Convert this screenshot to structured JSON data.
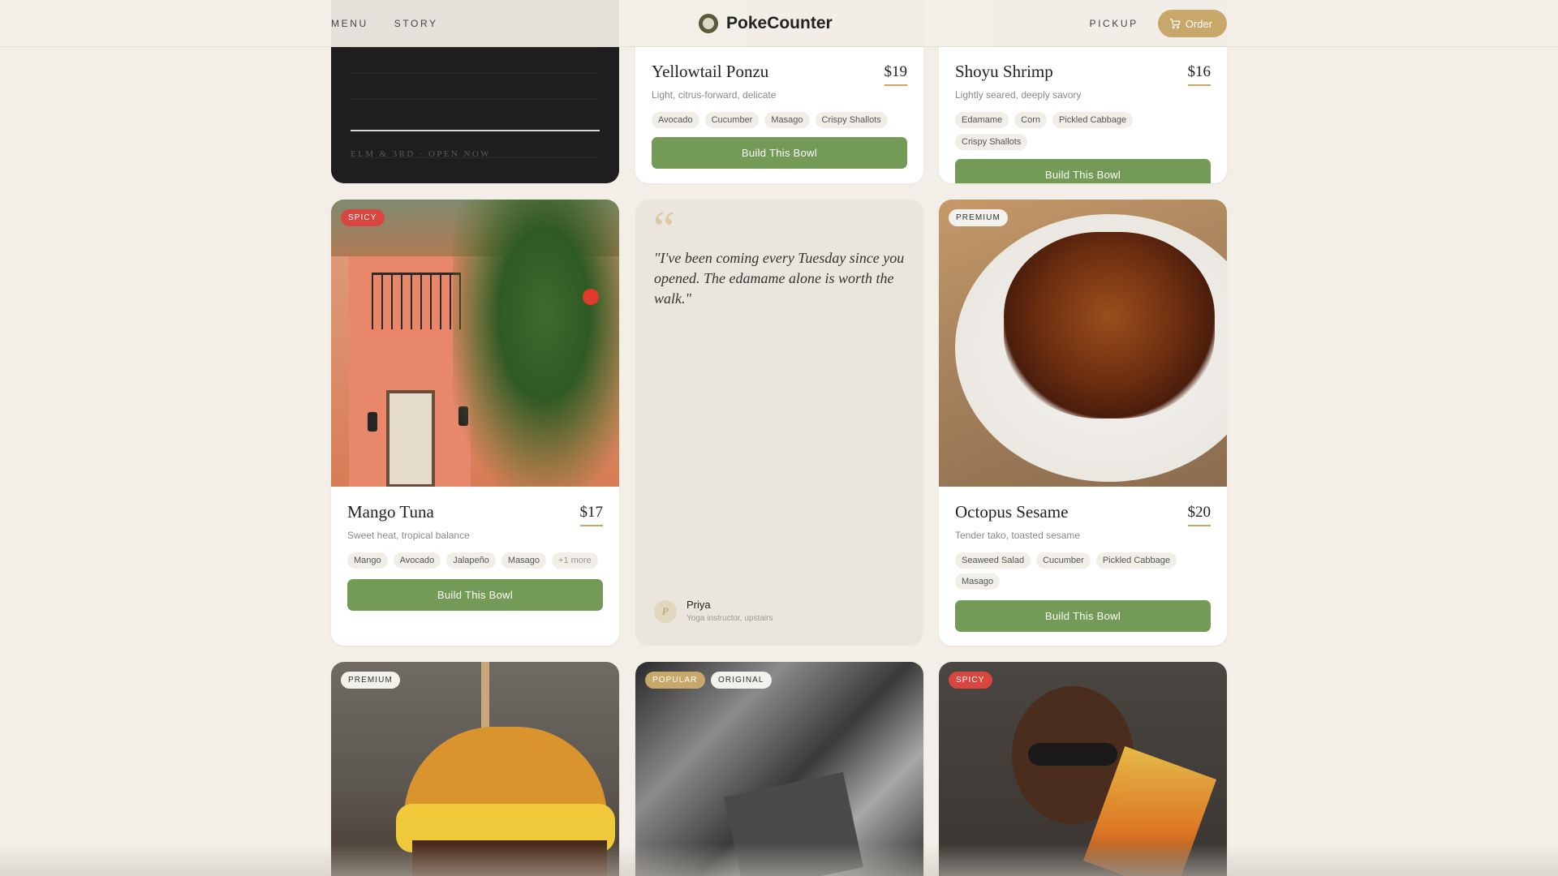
{
  "nav": {
    "menu_label": "MENU",
    "story_label": "STORY",
    "brand_name": "PokeCounter",
    "pickup_label": "PICKUP",
    "order_label": "Order"
  },
  "location": {
    "text": "ELM & 3RD · OPEN NOW"
  },
  "menu": {
    "yellowtail": {
      "title": "Yellowtail Ponzu",
      "price": "$19",
      "subtitle": "Light, citrus-forward, delicate",
      "tags": [
        "Avocado",
        "Cucumber",
        "Masago",
        "Crispy Shallots"
      ],
      "cta": "Build This Bowl"
    },
    "shrimp": {
      "title": "Shoyu Shrimp",
      "price": "$16",
      "subtitle": "Lightly seared, deeply savory",
      "tags": [
        "Edamame",
        "Corn",
        "Pickled Cabbage",
        "Crispy Shallots"
      ],
      "cta": "Build This Bowl"
    },
    "mango": {
      "badge": "SPICY",
      "title": "Mango Tuna",
      "price": "$17",
      "subtitle": "Sweet heat, tropical balance",
      "tags": [
        "Mango",
        "Avocado",
        "Jalapeño",
        "Masago"
      ],
      "more": "+1 more",
      "cta": "Build This Bowl"
    },
    "octopus": {
      "badge": "PREMIUM",
      "title": "Octopus Sesame",
      "price": "$20",
      "subtitle": "Tender tako, toasted sesame",
      "tags": [
        "Seaweed Salad",
        "Cucumber",
        "Pickled Cabbage",
        "Masago"
      ],
      "cta": "Build This Bowl"
    },
    "row3": {
      "left_badge": "PREMIUM",
      "mid_badge1": "POPULAR",
      "mid_badge2": "ORIGINAL",
      "right_badge": "SPICY"
    }
  },
  "testimonial": {
    "quote_mark": "“",
    "quote": "\"I've been coming every Tuesday since you opened. The edamame alone is worth the walk.\"",
    "avatar_initial": "P",
    "name": "Priya",
    "role": "Yoga instructor, upstairs"
  },
  "colors": {
    "background": "#f3efe8",
    "accent_gold": "#c7a76a",
    "button_green": "#739a57",
    "spicy_red": "#d9463f"
  },
  "icons": [
    "brand-logo-icon",
    "cart-icon",
    "quote-icon"
  ]
}
